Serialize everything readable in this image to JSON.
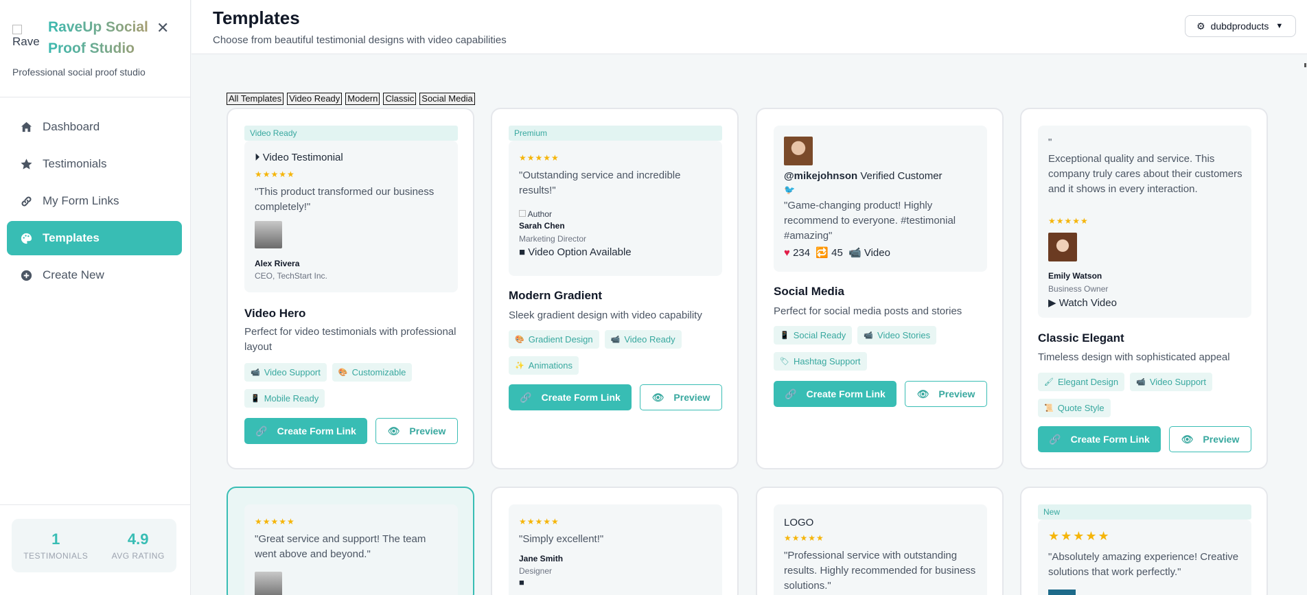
{
  "sidebar": {
    "logo_alt": "Ravel",
    "brand_title": "RaveUp Social Proof Studio",
    "brand_subtitle": "Professional social proof studio",
    "close_glyph": "✕",
    "nav": [
      {
        "label": "Dashboard",
        "icon": "home-icon"
      },
      {
        "label": "Testimonials",
        "icon": "star-icon"
      },
      {
        "label": "My Form Links",
        "icon": "link-icon"
      },
      {
        "label": "Templates",
        "icon": "palette-icon",
        "active": true
      },
      {
        "label": "Create New",
        "icon": "plus-circle-icon"
      }
    ],
    "stats": [
      {
        "value": "1",
        "label": "TESTIMONIALS"
      },
      {
        "value": "4.9",
        "label": "AVG RATING"
      }
    ]
  },
  "header": {
    "title": "Templates",
    "subtitle": "Choose from beautiful testimonial designs with video capabilities",
    "account": "dubdproducts"
  },
  "filters": [
    "All Templates",
    "Video Ready",
    "Modern",
    "Classic",
    "Social Media"
  ],
  "colors": {
    "accent": "#38bdb4",
    "star": "#f5b50a"
  },
  "cards": {
    "video_hero": {
      "badge": "Video Ready",
      "video_label": "Video Testimonial",
      "stars": "★★★★★",
      "quote": "\"This product transformed our business completely!\"",
      "author": "Alex Rivera",
      "role": "CEO, TechStart Inc.",
      "name": "Video Hero",
      "desc": "Perfect for video testimonials with professional layout",
      "tags": [
        "Video Support",
        "Customizable",
        "Mobile Ready"
      ],
      "cta": "Create Form Link",
      "preview": "Preview"
    },
    "modern_gradient": {
      "badge": "Premium",
      "stars": "★★★★★",
      "quote": "\"Outstanding service and incredible results!\"",
      "author_alt": "Author",
      "author": "Sarah Chen",
      "role": "Marketing Director",
      "video_label": "Video Option Available",
      "name": "Modern Gradient",
      "desc": "Sleek gradient design with video capability",
      "tags": [
        "Gradient Design",
        "Video Ready",
        "Animations"
      ],
      "cta": "Create Form Link",
      "preview": "Preview"
    },
    "social_media": {
      "handle": "@mikejohnson",
      "verified": "Verified Customer",
      "quote": "\"Game-changing product! Highly recommend to everyone. #testimonial #amazing\"",
      "likes": "234",
      "shares": "45",
      "video": "Video",
      "name": "Social Media",
      "desc": "Perfect for social media posts and stories",
      "tags": [
        "Social Ready",
        "Video Stories",
        "Hashtag Support"
      ],
      "cta": "Create Form Link",
      "preview": "Preview"
    },
    "classic_elegant": {
      "open_quote": "\"",
      "quote": "Exceptional quality and service. This company truly cares about their customers and it shows in every interaction.",
      "stars": "★★★★★",
      "author": "Emily Watson",
      "role": "Business Owner",
      "video_label": "Watch Video",
      "name": "Classic Elegant",
      "desc": "Timeless design with sophisticated appeal",
      "tags": [
        "Elegant Design",
        "Video Support",
        "Quote Style"
      ],
      "cta": "Create Form Link",
      "preview": "Preview"
    },
    "row2_a": {
      "stars": "★★★★★",
      "quote": "\"Great service and support! The team went above and beyond.\""
    },
    "row2_b": {
      "stars": "★★★★★",
      "quote": "\"Simply excellent!\"",
      "author": "Jane Smith",
      "role": "Designer"
    },
    "row2_c": {
      "logo": "LOGO",
      "stars": "★★★★★",
      "quote": "\"Professional service with outstanding results. Highly recommended for business solutions.\""
    },
    "row2_d": {
      "badge": "New",
      "stars": "★★★★★",
      "quote": "\"Absolutely amazing experience! Creative solutions that work perfectly.\""
    }
  }
}
